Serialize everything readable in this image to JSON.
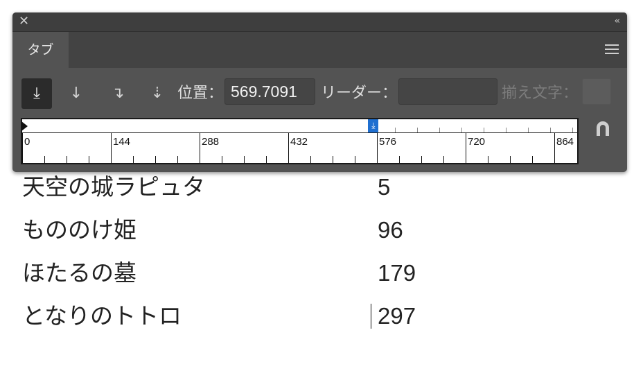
{
  "document": {
    "rows": [
      {
        "title": "天空の城ラピュタ",
        "value": "5"
      },
      {
        "title": "もののけ姫",
        "value": "96"
      },
      {
        "title": "ほたるの墓",
        "value": "179"
      },
      {
        "title": "となりのトトロ",
        "value": "297"
      }
    ]
  },
  "panel": {
    "close_glyph": "✕",
    "collapse_glyph": "‹‹",
    "tab_label": "タブ",
    "align_buttons": [
      {
        "name": "left-justified-tab",
        "glyph": "⤓",
        "active": true
      },
      {
        "name": "center-justified-tab",
        "glyph": "↓",
        "active": false
      },
      {
        "name": "right-justified-tab",
        "glyph": "↴",
        "active": false
      },
      {
        "name": "decimal-justified-tab",
        "glyph": "⇣",
        "active": false
      }
    ],
    "position_label": "位置：",
    "position_value": "569.7091",
    "leader_label": "リーダー：",
    "leader_value": "",
    "align_on_label": "揃え文字：",
    "align_on_value": "",
    "ruler": {
      "labels": [
        "0",
        "144",
        "288",
        "432",
        "576",
        "720",
        "864"
      ],
      "tab_stop_position": 569.7091,
      "tab_stop_glyph": "⤓"
    }
  },
  "colors": {
    "panel_bg": "#535353",
    "tab_active_bg": "#535353",
    "tab_stop_blue": "#1f6fd0"
  }
}
